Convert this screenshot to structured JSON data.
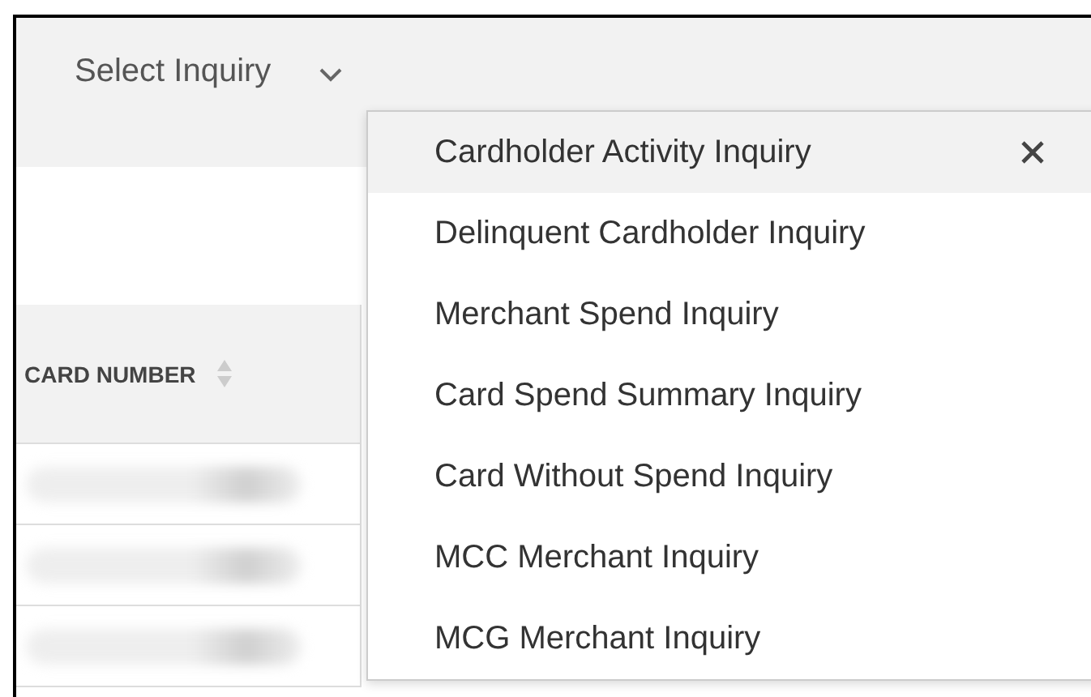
{
  "header": {
    "select_label": "Select Inquiry"
  },
  "table": {
    "columns": [
      {
        "label": "CARD NUMBER"
      }
    ],
    "rows": [
      {
        "redacted": true
      },
      {
        "redacted": true
      },
      {
        "redacted": true
      }
    ]
  },
  "menu": {
    "items": [
      {
        "label": "Cardholder Activity Inquiry",
        "selected": true
      },
      {
        "label": "Delinquent Cardholder Inquiry",
        "selected": false
      },
      {
        "label": "Merchant Spend Inquiry",
        "selected": false
      },
      {
        "label": "Card Spend Summary Inquiry",
        "selected": false
      },
      {
        "label": "Card Without Spend Inquiry",
        "selected": false
      },
      {
        "label": "MCC Merchant Inquiry",
        "selected": false
      },
      {
        "label": "MCG Merchant Inquiry",
        "selected": false
      }
    ]
  }
}
